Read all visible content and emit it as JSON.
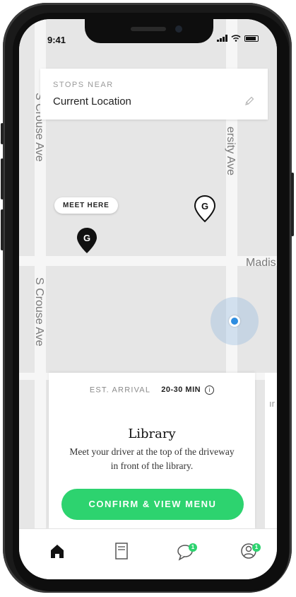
{
  "status": {
    "time": "9:41"
  },
  "stops": {
    "label": "STOPS NEAR",
    "value": "Current Location"
  },
  "map": {
    "streets": {
      "crouse_top": "S Crouse Ave",
      "crouse_bottom": "S Crouse Ave",
      "university": "ersity Ave",
      "madison": "Madis"
    },
    "meet_here": "MEET HERE",
    "pin_letter": "G"
  },
  "sheet": {
    "eta_label": "EST. ARRIVAL",
    "eta_value": "20-30 MIN",
    "info": "i",
    "title": "Library",
    "description": "Meet your driver at the top of the driveway in front of the library.",
    "confirm": "CONFIRM & VIEW MENU",
    "peek_text": "ır"
  },
  "tabs": {
    "home": "home-icon",
    "menu": "menu-icon",
    "chat": "chat-icon",
    "chat_badge": "1",
    "account": "account-icon",
    "account_badge": "1"
  },
  "colors": {
    "accent": "#2dd36f",
    "location": "#2e8de0"
  }
}
